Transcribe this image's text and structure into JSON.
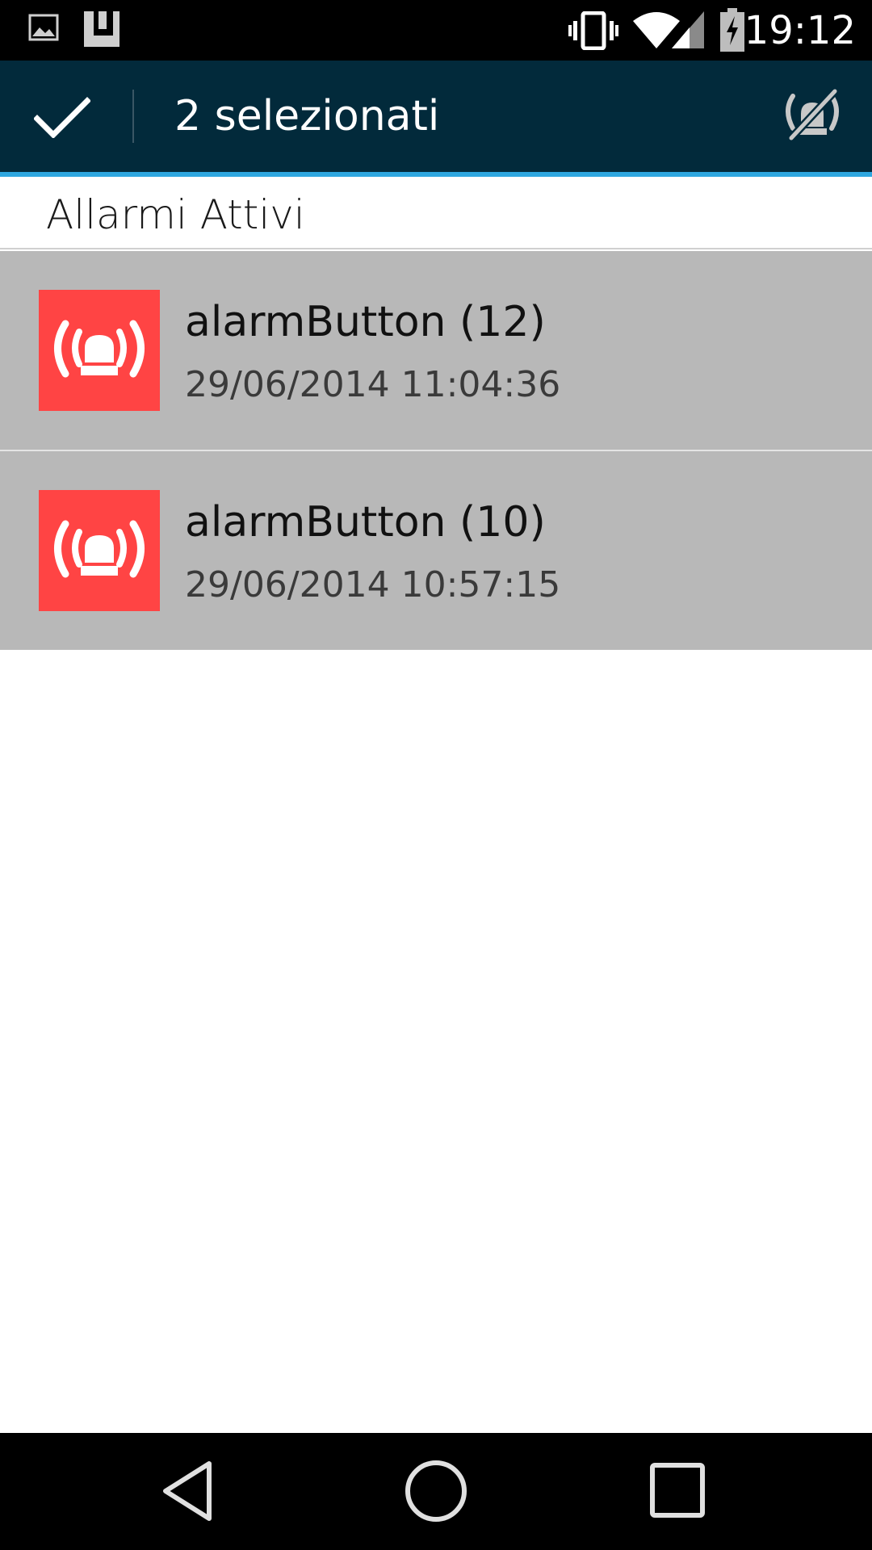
{
  "status_bar": {
    "time": "19:12",
    "icons": [
      "gallery-notification-icon",
      "app-notification-icon",
      "vibrate-icon",
      "wifi-icon",
      "cell-signal-icon",
      "battery-charging-icon"
    ]
  },
  "action_bar": {
    "done_icon": "check-icon",
    "title": "2 selezionati",
    "action_icon": "alarm-off-icon",
    "colors": {
      "background": "#022a3b",
      "underline": "#2ea7e0"
    }
  },
  "section": {
    "title": "Allarmi Attivi"
  },
  "alarms": [
    {
      "name": "alarmButton (12)",
      "timestamp": "29/06/2014 11:04:36",
      "icon": "siren-icon",
      "selected": true
    },
    {
      "name": "alarmButton (10)",
      "timestamp": "29/06/2014 10:57:15",
      "icon": "siren-icon",
      "selected": true
    }
  ],
  "colors": {
    "alarm_icon_bg": "#ff4444",
    "selected_row_bg": "#b8b8b8"
  },
  "nav_bar": {
    "buttons": [
      "back-icon",
      "home-icon",
      "recents-icon"
    ]
  }
}
